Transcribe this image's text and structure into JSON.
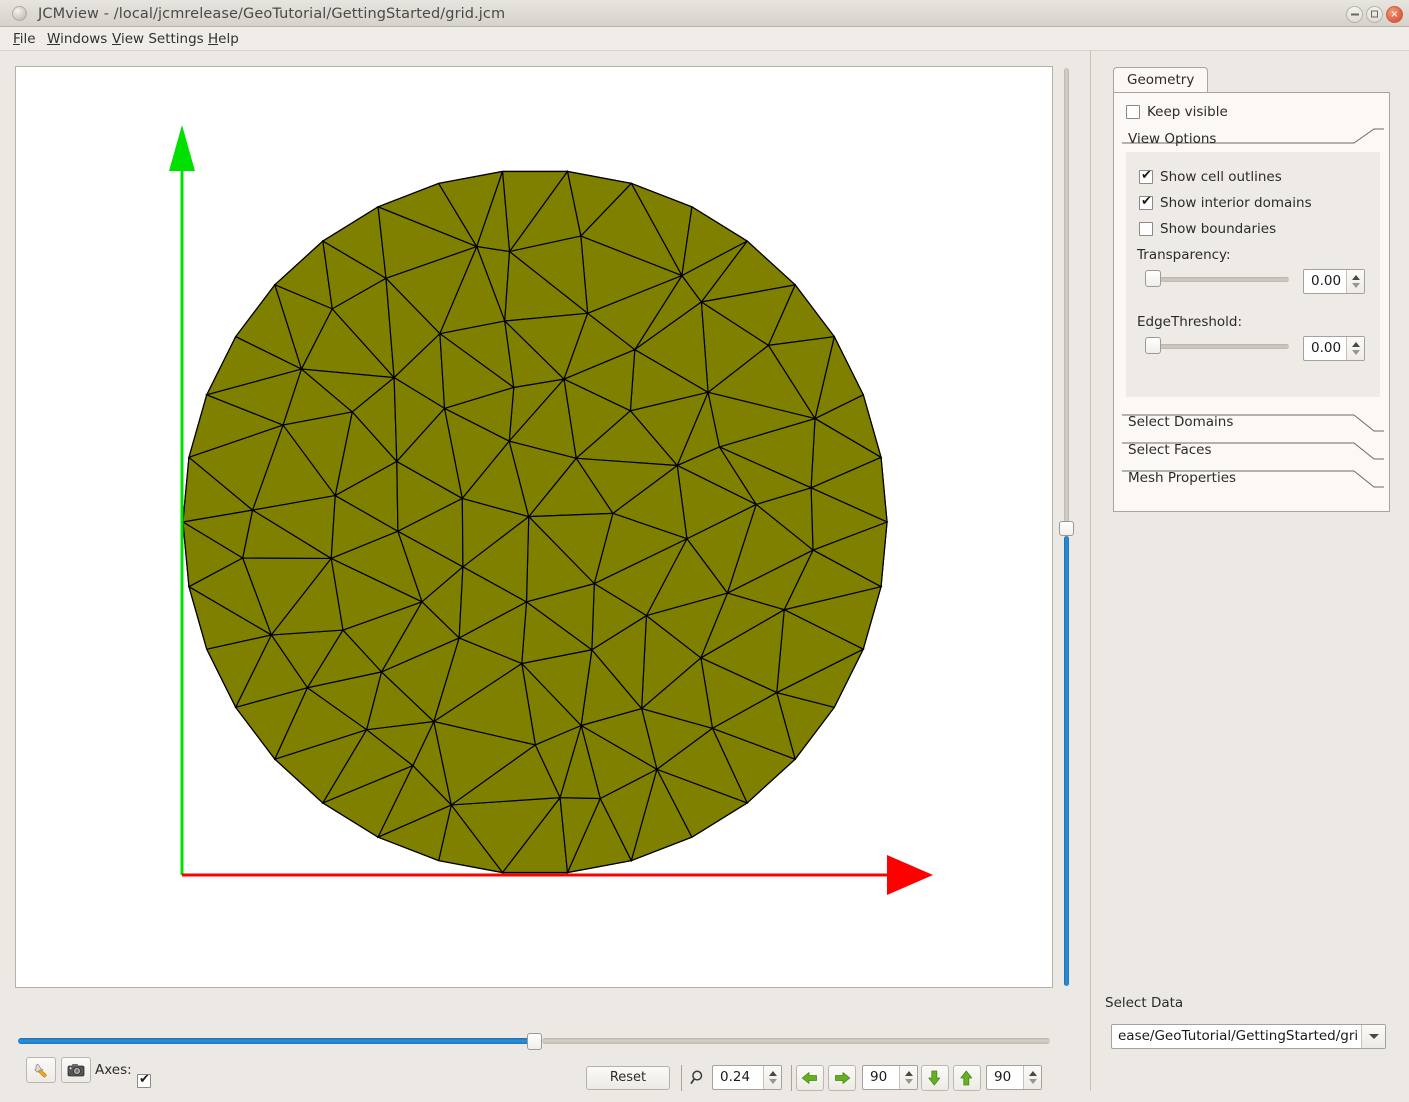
{
  "window": {
    "title": "JCMview - /local/jcmrelease/GeoTutorial/GettingStarted/grid.jcm",
    "app_icon": "circle-icon",
    "minimize_label": "minimize-icon",
    "maximize_label": "maximize-icon",
    "close_label": "×"
  },
  "menubar": {
    "items": [
      {
        "mnemonic": "F",
        "rest": "ile"
      },
      {
        "mnemonic": "W",
        "rest": "indows"
      },
      {
        "mnemonic": "V",
        "rest": "iew Settings"
      },
      {
        "mnemonic": "H",
        "rest": "elp"
      }
    ]
  },
  "viewport": {
    "background": "#ffffff",
    "mesh_fill": "#808000",
    "mesh_edge": "#000000",
    "x_axis_color": "#ff0000",
    "y_axis_color": "#00e000"
  },
  "bottom_toolbar": {
    "settings_icon": "wrench-icon",
    "snapshot_icon": "camera-icon",
    "axes_label": "Axes:",
    "axes_checked": true,
    "reset_label": "Reset",
    "zoom_icon": "magnifier-icon",
    "zoom_value": "0.24",
    "rotate_left_icon": "arrow-left-icon",
    "rotate_right_icon": "arrow-right-icon",
    "horizontal_angle": "90",
    "rotate_down_icon": "arrow-down-icon",
    "rotate_up_icon": "arrow-up-icon",
    "vertical_angle": "90"
  },
  "right_panel": {
    "tab_label": "Geometry",
    "keep_visible_label": "Keep visible",
    "keep_visible_checked": false,
    "view_options": {
      "header": "View Options",
      "show_cell_outlines_label": "Show cell outlines",
      "show_cell_outlines_checked": true,
      "show_interior_domains_label": "Show interior domains",
      "show_interior_domains_checked": true,
      "show_boundaries_label": "Show boundaries",
      "show_boundaries_checked": false,
      "transparency_label": "Transparency:",
      "transparency_value": "0.00",
      "edge_threshold_label": "EdgeThreshold:",
      "edge_threshold_value": "0.00"
    },
    "collapsed_groups": [
      "Select Domains",
      "Select Faces",
      "Mesh Properties"
    ],
    "select_data_label": "Select Data",
    "select_data_value": "ease/GeoTutorial/GettingStarted/grid.jcm",
    "select_data_dropdown_icon": "chevron-down-icon"
  }
}
